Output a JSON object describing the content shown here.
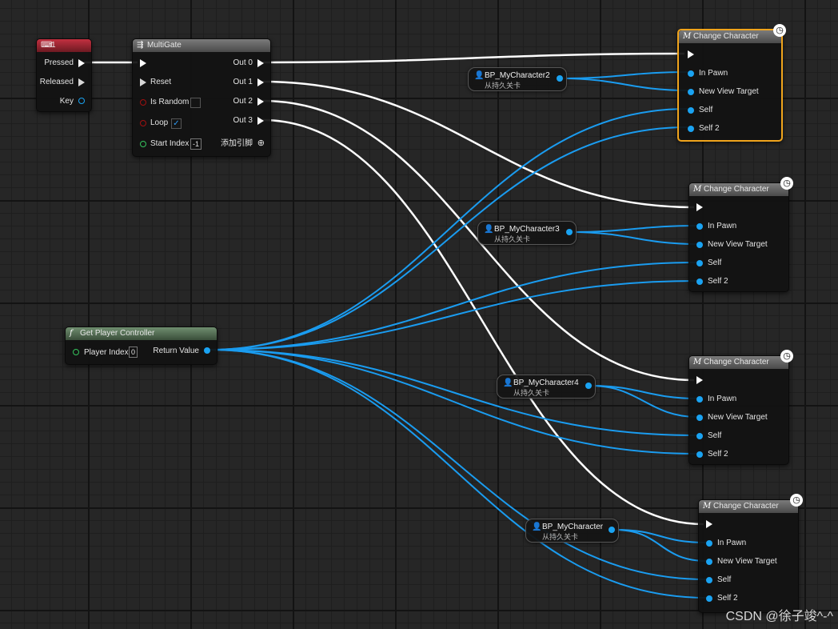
{
  "colors": {
    "exec_wire": "#ffffff",
    "object_wire": "#1a9cf0",
    "selected_border": "#f0a41c",
    "event_header": "#b02838",
    "function_header": "#5a7a5a",
    "macro_header": "#6a6a6a"
  },
  "event_node": {
    "icon": "keyboard-icon",
    "title": "1",
    "pins": {
      "pressed": "Pressed",
      "released": "Released",
      "key": "Key"
    }
  },
  "multigate": {
    "icon": "multigate-icon",
    "title": "MultiGate",
    "pins": {
      "reset": "Reset",
      "is_random": "Is Random",
      "loop": "Loop",
      "start_index": "Start Index",
      "start_index_value": "-1",
      "loop_checked": "✓",
      "add_pin": "添加引脚",
      "outs": [
        "Out 0",
        "Out 1",
        "Out 2",
        "Out 3"
      ]
    }
  },
  "get_player_controller": {
    "icon": "function-icon",
    "title": "Get Player Controller",
    "pins": {
      "player_index": "Player Index",
      "player_index_value": "0",
      "return_value": "Return Value"
    }
  },
  "variables": [
    {
      "name": "BP_MyCharacter2",
      "subtitle": "从持久关卡"
    },
    {
      "name": "BP_MyCharacter3",
      "subtitle": "从持久关卡"
    },
    {
      "name": "BP_MyCharacter4",
      "subtitle": "从持久关卡"
    },
    {
      "name": "BP_MyCharacter",
      "subtitle": "从持久关卡"
    }
  ],
  "change_character_nodes": [
    {
      "icon": "macro-icon",
      "title": "Change Character",
      "selected": true,
      "pins": {
        "in_pawn": "In Pawn",
        "new_view_target": "New View Target",
        "self": "Self",
        "self2": "Self 2"
      }
    },
    {
      "icon": "macro-icon",
      "title": "Change Character",
      "selected": false,
      "pins": {
        "in_pawn": "In Pawn",
        "new_view_target": "New View Target",
        "self": "Self",
        "self2": "Self 2"
      }
    },
    {
      "icon": "macro-icon",
      "title": "Change Character",
      "selected": false,
      "pins": {
        "in_pawn": "In Pawn",
        "new_view_target": "New View Target",
        "self": "Self",
        "self2": "Self 2"
      }
    },
    {
      "icon": "macro-icon",
      "title": "Change Character",
      "selected": false,
      "pins": {
        "in_pawn": "In Pawn",
        "new_view_target": "New View Target",
        "self": "Self",
        "self2": "Self 2"
      }
    }
  ],
  "watermark": "CSDN @徐子竣^-^"
}
